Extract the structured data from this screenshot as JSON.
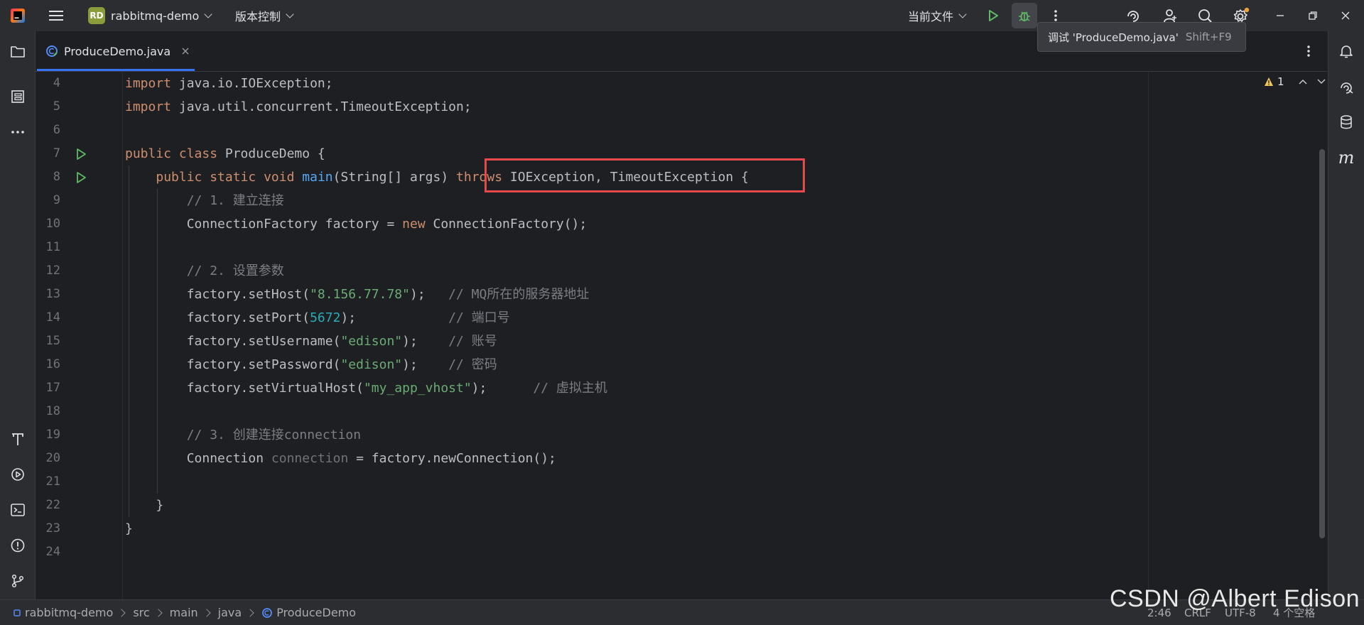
{
  "titlebar": {
    "project_badge": "RD",
    "project_name": "rabbitmq-demo",
    "vcs_label": "版本控制",
    "run_config": "当前文件"
  },
  "tooltip": {
    "text": "调试 'ProduceDemo.java'",
    "shortcut": "Shift+F9"
  },
  "tab": {
    "file_name": "ProduceDemo.java"
  },
  "inspections": {
    "warning_count": "1"
  },
  "lines": [
    {
      "n": "4"
    },
    {
      "n": "5"
    },
    {
      "n": "6"
    },
    {
      "n": "7"
    },
    {
      "n": "8"
    },
    {
      "n": "9"
    },
    {
      "n": "10"
    },
    {
      "n": "11"
    },
    {
      "n": "12"
    },
    {
      "n": "13"
    },
    {
      "n": "14"
    },
    {
      "n": "15"
    },
    {
      "n": "16"
    },
    {
      "n": "17"
    },
    {
      "n": "18"
    },
    {
      "n": "19"
    },
    {
      "n": "20"
    },
    {
      "n": "21"
    },
    {
      "n": "22"
    },
    {
      "n": "23"
    },
    {
      "n": "24"
    }
  ],
  "code": {
    "l4": {
      "kw": "import",
      "rest": " java.io.IOException;"
    },
    "l5": {
      "kw": "import",
      "rest": " java.util.concurrent.TimeoutException;"
    },
    "l7": {
      "kw": "public class",
      "rest": " ProduceDemo {"
    },
    "l8": {
      "indent": "    ",
      "kw": "public static void",
      "sp": " ",
      "fn": "main",
      "args": "(String[] args) ",
      "throws": "throws",
      "exc": " IOException, TimeoutException",
      "tail": " {"
    },
    "l9": {
      "indent": "        ",
      "comment": "// 1. 建立连接"
    },
    "l10": {
      "indent": "        ",
      "a": "ConnectionFactory factory = ",
      "kw": "new",
      "b": " ConnectionFactory();"
    },
    "l12": {
      "indent": "        ",
      "comment": "// 2. 设置参数"
    },
    "l13": {
      "indent": "        ",
      "a": "factory.setHost(",
      "str": "\"8.156.77.78\"",
      "b": ");   ",
      "comment": "// MQ所在的服务器地址"
    },
    "l14": {
      "indent": "        ",
      "a": "factory.setPort(",
      "num": "5672",
      "b": ");            ",
      "comment": "// 端口号"
    },
    "l15": {
      "indent": "        ",
      "a": "factory.setUsername(",
      "str": "\"edison\"",
      "b": ");    ",
      "comment": "// 账号"
    },
    "l16": {
      "indent": "        ",
      "a": "factory.setPassword(",
      "str": "\"edison\"",
      "b": ");    ",
      "comment": "// 密码"
    },
    "l17": {
      "indent": "        ",
      "a": "factory.setVirtualHost(",
      "str": "\"my_app_vhost\"",
      "b": ");      ",
      "comment": "// 虚拟主机"
    },
    "l19": {
      "indent": "        ",
      "comment": "// 3. 创建连接connection"
    },
    "l20": {
      "indent": "        ",
      "a": "Connection ",
      "unused": "connection",
      "b": " = factory.newConnection();"
    },
    "l22": {
      "text": "    }"
    },
    "l23": {
      "text": "}"
    }
  },
  "statusbar": {
    "breadcrumbs": [
      "rabbitmq-demo",
      "src",
      "main",
      "java",
      "ProduceDemo"
    ],
    "position": "2:46",
    "line_sep": "CRLF",
    "encoding": "UTF-8",
    "indent": "4 个空格"
  },
  "watermark": "CSDN @Albert Edison",
  "colors": {
    "keyword": "#cf8e6d",
    "string": "#6aab73",
    "number": "#2aacb8",
    "comment": "#7a7e85",
    "function": "#56a8f5",
    "highlight_box": "#e8474c",
    "accent": "#3574f0"
  }
}
